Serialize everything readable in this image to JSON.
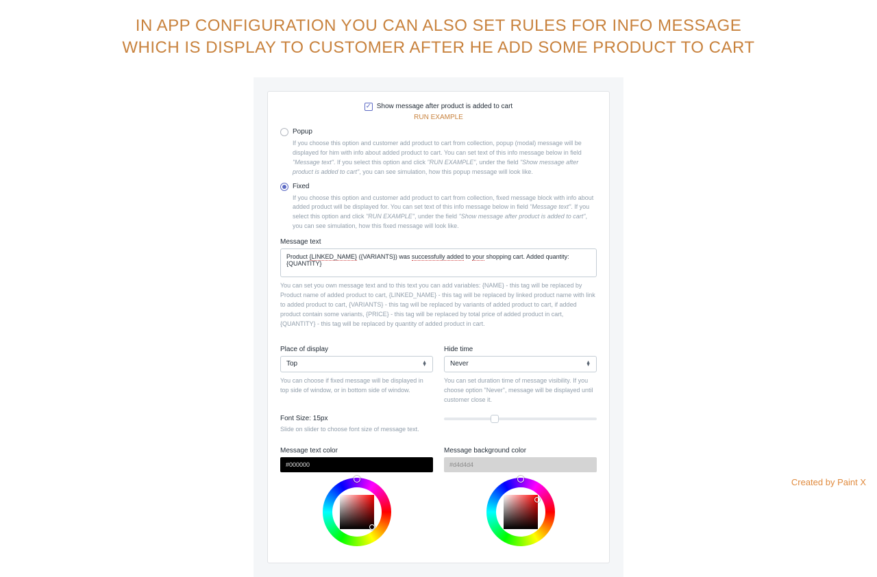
{
  "headline": {
    "line1": "IN APP CONFIGURATION YOU CAN ALSO SET RULES FOR INFO MESSAGE",
    "line2": "WHICH IS DISPLAY TO CUSTOMER AFTER HE ADD SOME PRODUCT TO CART"
  },
  "credit": "Created by Paint X",
  "form": {
    "show_checkbox_label": "Show message after product is added to cart",
    "show_checkbox_checked": true,
    "run_example": "RUN EXAMPLE",
    "popup": {
      "label": "Popup",
      "selected": false,
      "desc_plain_1": "If you choose this option and customer add product to cart from collection, popup (modal) message will be displayed for him with info about added product to cart. You can set text of this info message below in field ",
      "desc_em_1": "\"Message text\"",
      "desc_plain_2": ". If you select this option and click ",
      "desc_em_2": "\"RUN EXAMPLE\"",
      "desc_plain_3": ", under the field ",
      "desc_em_3": "\"Show message after product is added to cart\"",
      "desc_plain_4": ", you can see simulation, how this popup message will look like."
    },
    "fixed": {
      "label": "Fixed",
      "selected": true,
      "desc_plain_1": "If you choose this option and customer add product to cart from collection, fixed message block with info about added product will be displayed for. You can set text of this info message below in field ",
      "desc_em_1": "\"Message text\"",
      "desc_plain_2": ". If you select this option and click ",
      "desc_em_2": "\"RUN EXAMPLE\"",
      "desc_plain_3": ", under the field ",
      "desc_em_3": "\"Show message after product is added to cart\"",
      "desc_plain_4": ", you can see simulation, how this fixed message will look like."
    },
    "message_text": {
      "label": "Message text",
      "value_prefix": "Product ",
      "value_linked": "{LINKED_NAME}",
      "value_mid1": " ({VARIANTS}) was ",
      "value_success": "successfully added",
      "value_mid2": " to ",
      "value_your": "your",
      "value_tail": " shopping cart. Added quantity: {QUANTITY}",
      "helper": "You can set you own message text and to this text you can add variables: {NAME} - this tag will be replaced by Product name of added product to cart, {LINKED_NAME} - this tag will be replaced by linked product name with link to added product to cart, {VARIANTS} - this tag will be replaced by variants of added product to cart, if added product contain some variants, {PRICE} - this tag will be replaced by total price of added product in cart, {QUANTITY} - this tag will be replaced by quantity of added product in cart."
    },
    "place": {
      "label": "Place of display",
      "value": "Top",
      "helper": "You can choose if fixed message will be displayed in top side of window, or in bottom side of window."
    },
    "hide": {
      "label": "Hide time",
      "value": "Never",
      "helper": "You can set duration time of message visibility. If you choose option \"Never\", message will be displayed until customer close it."
    },
    "fontsize": {
      "label": "Font Size: 15px",
      "helper": "Slide on slider to choose font size of message text."
    },
    "text_color": {
      "label": "Message text color",
      "value": "#000000"
    },
    "bg_color": {
      "label": "Message background color",
      "value": "#d4d4d4"
    }
  }
}
